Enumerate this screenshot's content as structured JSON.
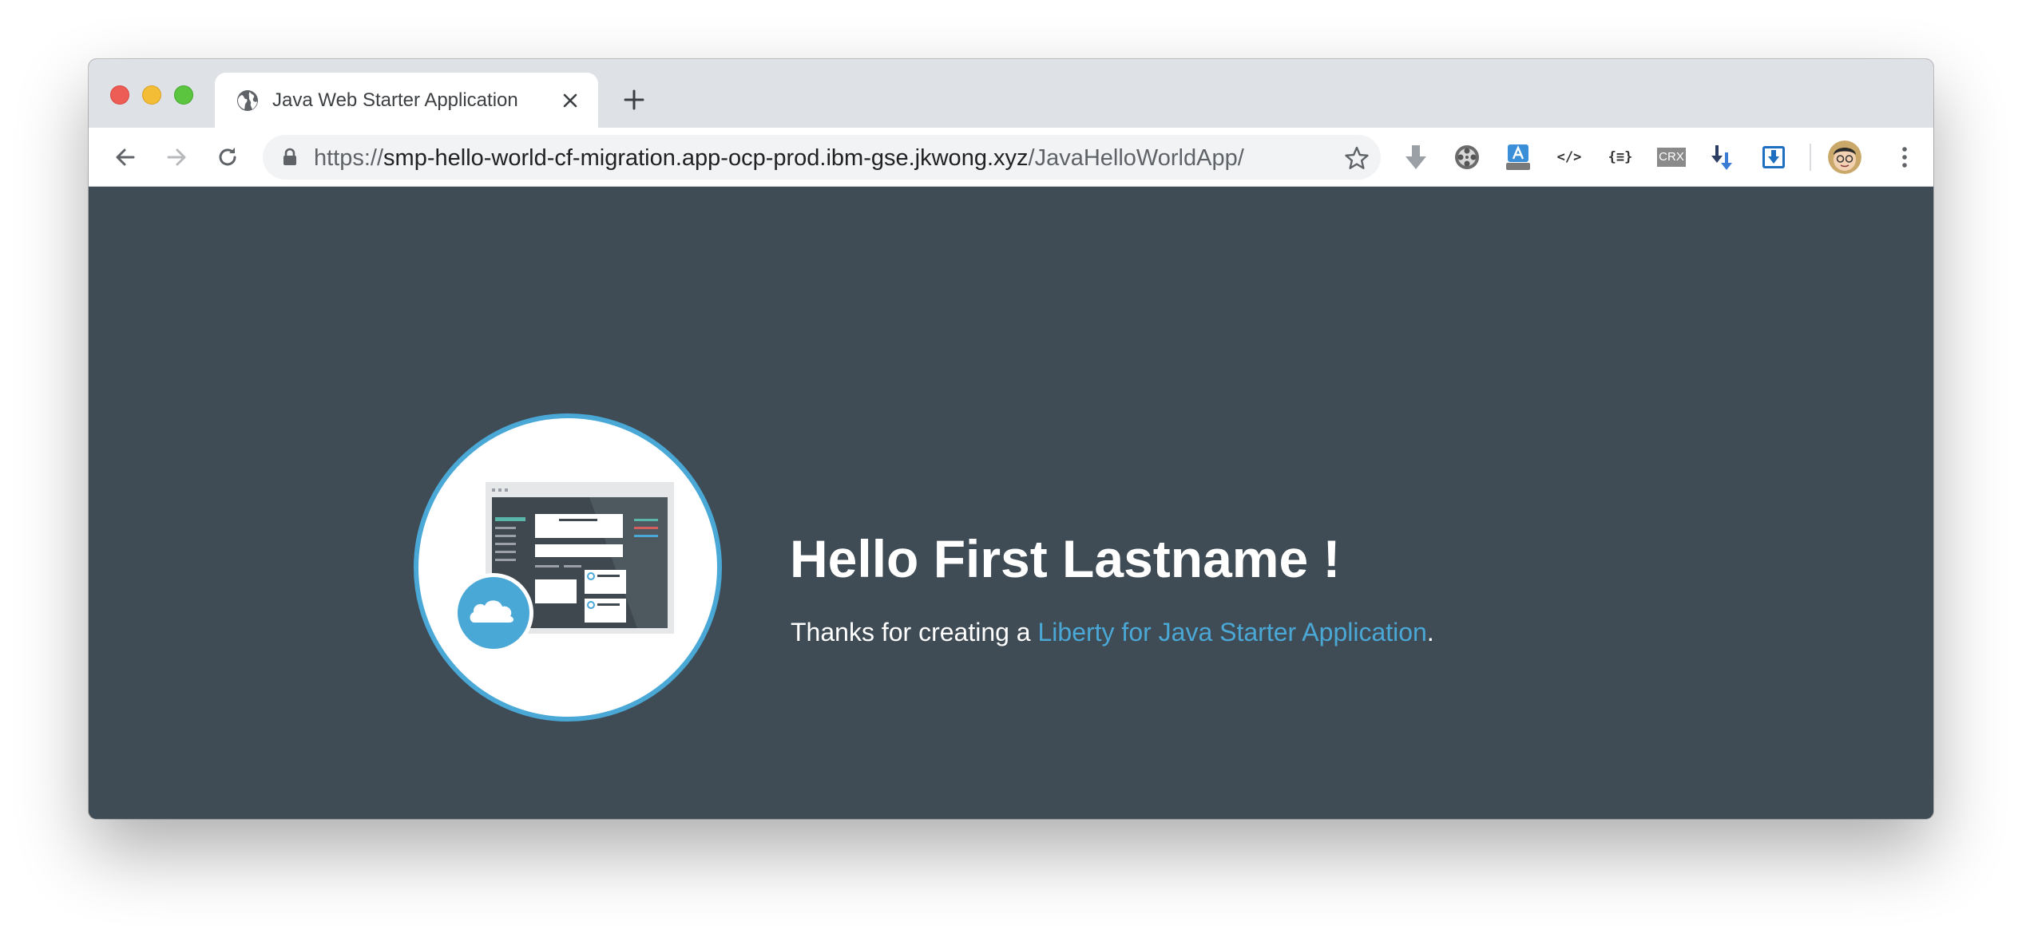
{
  "browser": {
    "tab": {
      "title": "Java Web Starter Application",
      "favicon": "globe-icon"
    },
    "address_bar": {
      "scheme": "https://",
      "host": "smp-hello-world-cf-migration.app-ocp-prod.ibm-gse.jkwong.xyz",
      "path": "/JavaHelloWorldApp/"
    },
    "extensions": [
      {
        "name": "download-arrow-icon"
      },
      {
        "name": "film-reel-icon"
      },
      {
        "name": "translate-icon"
      },
      {
        "name": "code-icon",
        "label": "</>"
      },
      {
        "name": "json-icon",
        "label": "{≡}"
      },
      {
        "name": "crx-icon",
        "label": "CRX"
      },
      {
        "name": "sort-download-icon"
      },
      {
        "name": "save-download-icon"
      }
    ],
    "colors": {
      "tabstrip": "#dee1e6",
      "accent_link": "#4aa8d6",
      "page_background": "#404c55"
    }
  },
  "page": {
    "heading": "Hello First Lastname !",
    "message_prefix": "Thanks for creating a ",
    "message_link": "Liberty for Java Starter Application",
    "message_suffix": ".",
    "hero_image": "cloud-app-illustration"
  }
}
